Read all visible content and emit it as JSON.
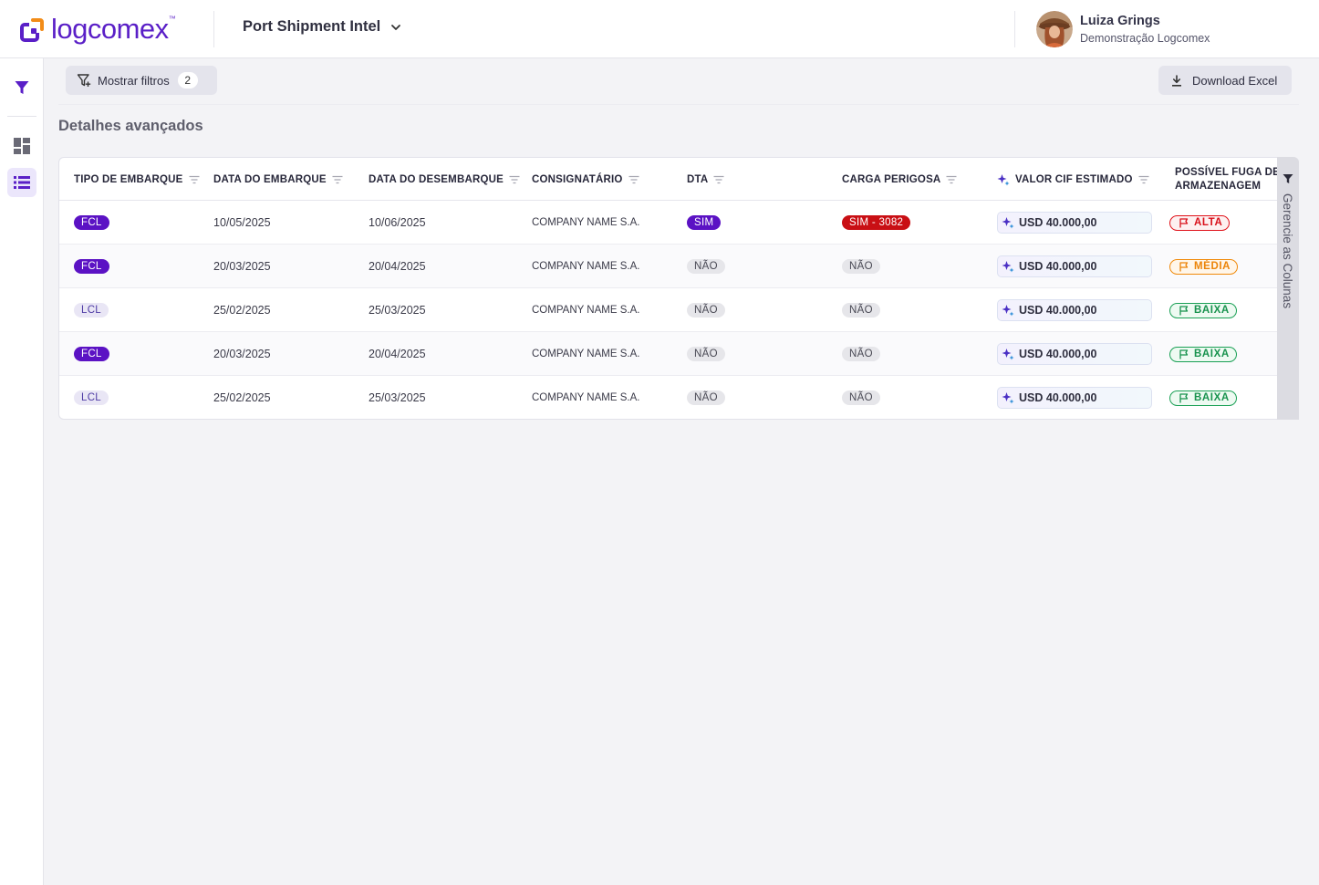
{
  "brand": {
    "name": "logcomex",
    "tm": "™",
    "color": "#5a1fc7"
  },
  "header": {
    "product": "Port Shipment Intel",
    "user": {
      "name": "Luiza Grings",
      "org": "Demonstração Logcomex"
    }
  },
  "sidebar": {
    "items": [
      {
        "icon": "filter-icon",
        "active": false
      },
      {
        "icon": "dashboard-icon",
        "active": false
      },
      {
        "icon": "list-view-icon",
        "active": true
      }
    ]
  },
  "toolbar": {
    "filters_label": "Mostrar filtros",
    "filters_count": "2",
    "download_label": "Download Excel"
  },
  "section": {
    "title": "Detalhes avançados"
  },
  "table": {
    "columns": [
      "TIPO DE EMBARQUE",
      "DATA DO EMBARQUE",
      "DATA DO DESEMBARQUE",
      "CONSIGNATÁRIO",
      "DTA",
      "CARGA PERIGOSA",
      "VALOR CIF ESTIMADO",
      "POSSÍVEL FUGA DE ARMAZENAGEM"
    ],
    "col_header_last_line1": "POSSÍVEL FUGA DE",
    "col_header_last_line2": "ARMAZENAGEM",
    "rows": [
      {
        "tipo": "FCL",
        "embarque": "10/05/2025",
        "desembarque": "10/06/2025",
        "consignatario": "COMPANY NAME S.A.",
        "dta": "SIM",
        "carga": "SIM - 3082",
        "cif": "USD 40.000,00",
        "fuga": "ALTA"
      },
      {
        "tipo": "FCL",
        "embarque": "20/03/2025",
        "desembarque": "20/04/2025",
        "consignatario": "COMPANY NAME S.A.",
        "dta": "NÃO",
        "carga": "NÃO",
        "cif": "USD 40.000,00",
        "fuga": "MÉDIA"
      },
      {
        "tipo": "LCL",
        "embarque": "25/02/2025",
        "desembarque": "25/03/2025",
        "consignatario": "COMPANY NAME S.A.",
        "dta": "NÃO",
        "carga": "NÃO",
        "cif": "USD 40.000,00",
        "fuga": "BAIXA"
      },
      {
        "tipo": "FCL",
        "embarque": "20/03/2025",
        "desembarque": "20/04/2025",
        "consignatario": "COMPANY NAME S.A.",
        "dta": "NÃO",
        "carga": "NÃO",
        "cif": "USD 40.000,00",
        "fuga": "BAIXA"
      },
      {
        "tipo": "LCL",
        "embarque": "25/02/2025",
        "desembarque": "25/03/2025",
        "consignatario": "COMPANY NAME S.A.",
        "dta": "NÃO",
        "carga": "NÃO",
        "cif": "USD 40.000,00",
        "fuga": "BAIXA"
      }
    ]
  },
  "column_panel": {
    "label": "Gerencie as Colunas"
  },
  "colors": {
    "primary": "#5b12c4",
    "danger": "#c90f14",
    "risk_high": "#d9101a",
    "risk_medium": "#ec8408",
    "risk_low": "#17924d"
  }
}
